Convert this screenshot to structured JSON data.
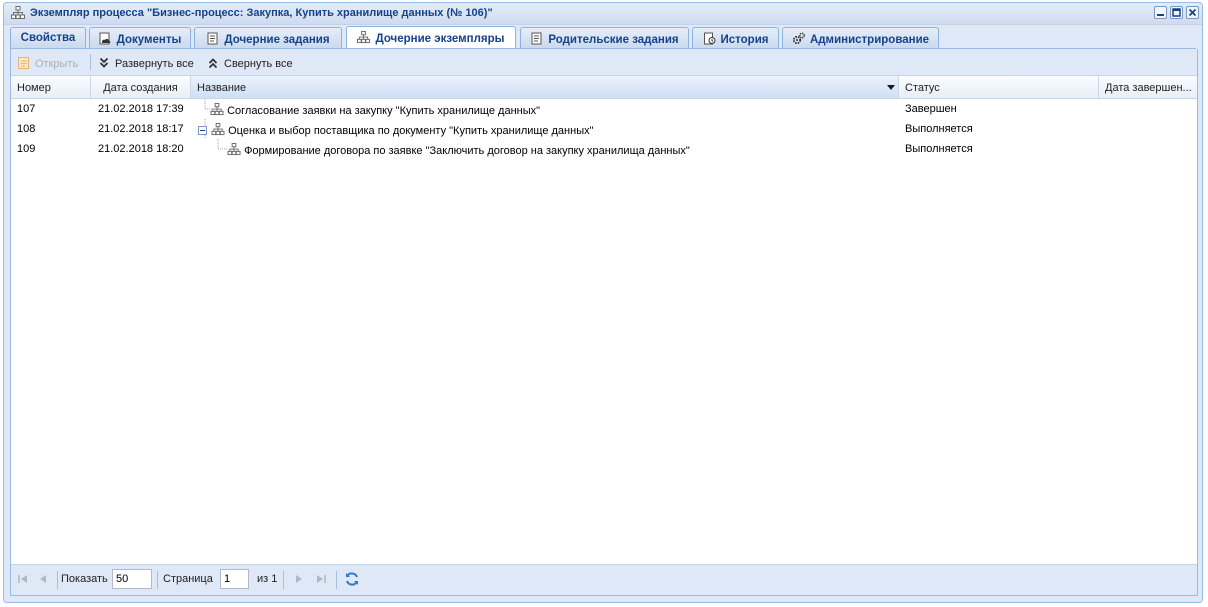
{
  "window": {
    "title": "Экземпляр процесса \"Бизнес-процесс: Закупка, Купить хранилище данных (№ 106)\""
  },
  "tabs": [
    {
      "label": "Свойства",
      "icon": "none"
    },
    {
      "label": "Документы",
      "icon": "cloud-doc-icon"
    },
    {
      "label": "Дочерние задания",
      "icon": "task-list-icon"
    },
    {
      "label": "Дочерние экземпляры",
      "icon": "org-chart-icon",
      "active": true
    },
    {
      "label": "Родительские задания",
      "icon": "task-list-icon"
    },
    {
      "label": "История",
      "icon": "history-icon"
    },
    {
      "label": "Администрирование",
      "icon": "gears-icon"
    }
  ],
  "toolbar": {
    "open_label": "Открыть",
    "expand_all_label": "Развернуть все",
    "collapse_all_label": "Свернуть все"
  },
  "grid": {
    "columns": [
      "Номер",
      "Дата создания",
      "Название",
      "Статус",
      "Дата завершен..."
    ],
    "rows": [
      {
        "number": "107",
        "created": "21.02.2018 17:39",
        "name": "Согласование заявки на закупку \"Купить хранилище данных\"",
        "status": "Завершен",
        "finished": ""
      },
      {
        "number": "108",
        "created": "21.02.2018 18:17",
        "name": "Оценка и выбор поставщика по документу \"Купить хранилище данных\"",
        "status": "Выполняется",
        "finished": ""
      },
      {
        "number": "109",
        "created": "21.02.2018 18:20",
        "name": "Формирование договора по заявке \"Заключить договор на закупку хранилища данных\"",
        "status": "Выполняется",
        "finished": ""
      }
    ]
  },
  "pager": {
    "show_label": "Показать",
    "page_size": "50",
    "page_label": "Страница",
    "page": "1",
    "of_label": "из 1"
  },
  "colors": {
    "title_text": "#15428b",
    "frame": "#dfe8f6",
    "border": "#99bbe8"
  }
}
